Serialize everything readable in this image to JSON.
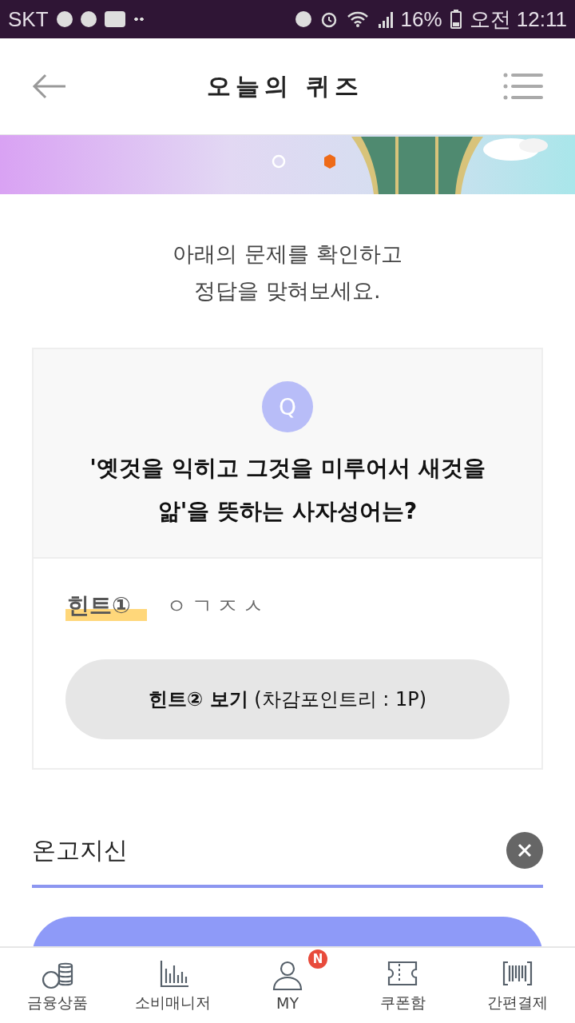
{
  "status_bar": {
    "carrier": "SKT",
    "battery": "16%",
    "time": "오전 12:11"
  },
  "header": {
    "title": "오늘의 퀴즈"
  },
  "intro": "아래의 문제를 확인하고\n정답을 맞혀보세요.",
  "question": {
    "badge": "Q",
    "text": "'옛것을 익히고 그것을 미루어서 새것을 앎'을 뜻하는 사자성어는?"
  },
  "hints": [
    {
      "label": "힌트①",
      "value": "ㅇㄱㅈㅅ"
    }
  ],
  "hint_button": {
    "label": "**힌트② 보기** (차감포인트리 : 1P)"
  },
  "answer": {
    "value": "온고지신"
  },
  "nav": [
    {
      "kind": "coins",
      "label": "금융상품"
    },
    {
      "kind": "chart",
      "label": "소비매니저"
    },
    {
      "kind": "person",
      "label": "MY",
      "badge": "N"
    },
    {
      "kind": "ticket",
      "label": "쿠폰함"
    },
    {
      "kind": "barcode",
      "label": "간편결제"
    }
  ]
}
